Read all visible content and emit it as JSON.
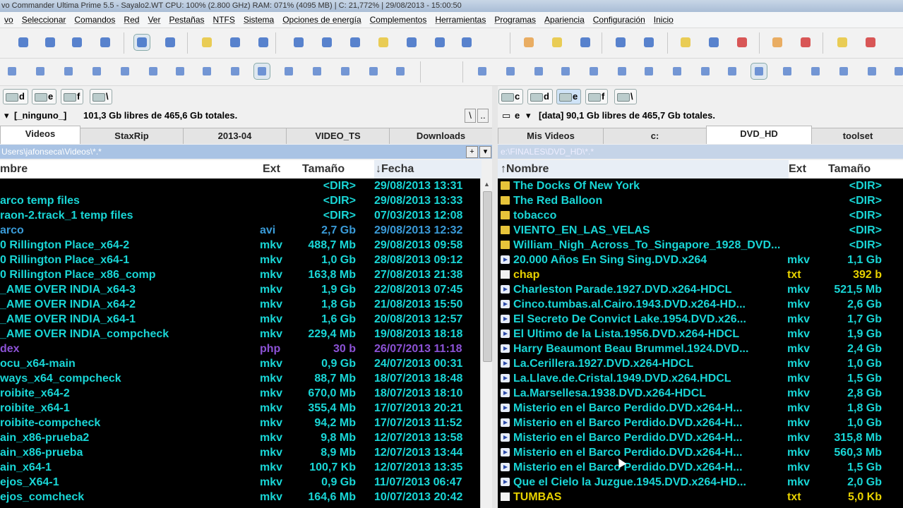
{
  "window": {
    "title": "vo  Commander Ultima Prime 5.5 - Sayalo2.WT  CPU: 100% (2.800 GHz)  RAM: 071% (4095 MB) | C: 21,772% | 29/08/2013 - 15:00:50"
  },
  "menu": [
    "vo",
    "Seleccionar",
    "Comandos",
    "Red",
    "Ver",
    "Pestañas",
    "NTFS",
    "Sistema",
    "Opciones de energía",
    "Complementos",
    "Herramientas",
    "Programas",
    "Apariencia",
    "Configuración",
    "Inicio"
  ],
  "toolbar_colors": {
    "accent_blue": "#3d6fc7",
    "orange": "#e8a14a",
    "yellow": "#e8c63a",
    "red": "#d43b3b"
  },
  "left": {
    "drives": [
      "d",
      "e",
      "f",
      "\\"
    ],
    "info_bullet": "▾",
    "info_drive": "[_ninguno_]",
    "info_text": "101,3 Gb libres de 465,6 Gb totales.",
    "info_btn_backslash": "\\",
    "info_btn_dots": "..",
    "tabs": [
      "Videos",
      "StaxRip",
      "2013-04",
      "VIDEO_TS",
      "Downloads"
    ],
    "active_tab": 0,
    "path": "Users\\jafonseca\\Videos\\*.*",
    "path_btn_plus": "+",
    "path_btn_down": "▾",
    "headers": {
      "name": "mbre",
      "ext": "Ext",
      "size": "Tamaño",
      "date": "↓Fecha"
    },
    "rows": [
      {
        "name": "",
        "ext": "",
        "size": "<DIR>",
        "date": "29/08/2013 13:31",
        "color": "cyan"
      },
      {
        "name": "arco temp files",
        "ext": "",
        "size": "<DIR>",
        "date": "29/08/2013 13:33",
        "color": "cyan"
      },
      {
        "name": "raon-2.track_1 temp files",
        "ext": "",
        "size": "<DIR>",
        "date": "07/03/2013 12:08",
        "color": "cyan"
      },
      {
        "name": "arco",
        "ext": "avi",
        "size": "2,7 Gb",
        "date": "29/08/2013 12:32",
        "color": "blue"
      },
      {
        "name": "0 Rillington Place_x64-2",
        "ext": "mkv",
        "size": "488,7 Mb",
        "date": "29/08/2013 09:58",
        "color": "cyan"
      },
      {
        "name": "0 Rillington Place_x64-1",
        "ext": "mkv",
        "size": "1,0 Gb",
        "date": "28/08/2013 09:12",
        "color": "cyan"
      },
      {
        "name": "0 Rillington Place_x86_comp",
        "ext": "mkv",
        "size": "163,8 Mb",
        "date": "27/08/2013 21:38",
        "color": "cyan"
      },
      {
        "name": "_AME OVER INDIA_x64-3",
        "ext": "mkv",
        "size": "1,9 Gb",
        "date": "22/08/2013 07:45",
        "color": "cyan"
      },
      {
        "name": "_AME OVER INDIA_x64-2",
        "ext": "mkv",
        "size": "1,8 Gb",
        "date": "21/08/2013 15:50",
        "color": "cyan"
      },
      {
        "name": "_AME OVER INDIA_x64-1",
        "ext": "mkv",
        "size": "1,6 Gb",
        "date": "20/08/2013 12:57",
        "color": "cyan"
      },
      {
        "name": "_AME OVER INDIA_compcheck",
        "ext": "mkv",
        "size": "229,4 Mb",
        "date": "19/08/2013 18:18",
        "color": "cyan"
      },
      {
        "name": "dex",
        "ext": "php",
        "size": "30 b",
        "date": "26/07/2013 11:18",
        "color": "purple"
      },
      {
        "name": "ocu_x64-main",
        "ext": "mkv",
        "size": "0,9 Gb",
        "date": "24/07/2013 00:31",
        "color": "cyan"
      },
      {
        "name": "ways_x64_compcheck",
        "ext": "mkv",
        "size": "88,7 Mb",
        "date": "18/07/2013 18:48",
        "color": "cyan"
      },
      {
        "name": "roibite_x64-2",
        "ext": "mkv",
        "size": "670,0 Mb",
        "date": "18/07/2013 18:10",
        "color": "cyan"
      },
      {
        "name": "roibite_x64-1",
        "ext": "mkv",
        "size": "355,4 Mb",
        "date": "17/07/2013 20:21",
        "color": "cyan"
      },
      {
        "name": "roibite-compcheck",
        "ext": "mkv",
        "size": "94,2 Mb",
        "date": "17/07/2013 11:52",
        "color": "cyan"
      },
      {
        "name": "ain_x86-prueba2",
        "ext": "mkv",
        "size": "9,8 Mb",
        "date": "12/07/2013 13:58",
        "color": "cyan"
      },
      {
        "name": "ain_x86-prueba",
        "ext": "mkv",
        "size": "8,9 Mb",
        "date": "12/07/2013 13:44",
        "color": "cyan"
      },
      {
        "name": "ain_x64-1",
        "ext": "mkv",
        "size": "100,7 Kb",
        "date": "12/07/2013 13:35",
        "color": "cyan"
      },
      {
        "name": "ejos_X64-1",
        "ext": "mkv",
        "size": "0,9 Gb",
        "date": "11/07/2013 06:47",
        "color": "cyan"
      },
      {
        "name": "ejos_comcheck",
        "ext": "mkv",
        "size": "164,6 Mb",
        "date": "10/07/2013 20:42",
        "color": "cyan"
      }
    ],
    "scroll_up": "▲"
  },
  "right": {
    "drives": [
      "c",
      "d",
      "e",
      "f",
      "\\"
    ],
    "info_bullet": "▭",
    "info_drive": "e",
    "info_text": "[data]  90,1 Gb libres de 465,7 Gb totales.",
    "tabs": [
      "Mis Videos",
      "c:",
      "DVD_HD",
      "toolset"
    ],
    "active_tab": 2,
    "path": "e:\\FINALES\\DVD_HD\\*.*",
    "headers": {
      "name": "↑Nombre",
      "ext": "Ext",
      "size": "Tamaño"
    },
    "rows": [
      {
        "icon": "folder",
        "name": "The Docks Of New York",
        "ext": "",
        "size": "<DIR>",
        "color": "cyan"
      },
      {
        "icon": "folder",
        "name": "The Red Balloon",
        "ext": "",
        "size": "<DIR>",
        "color": "cyan"
      },
      {
        "icon": "folder",
        "name": "tobacco",
        "ext": "",
        "size": "<DIR>",
        "color": "cyan"
      },
      {
        "icon": "folder",
        "name": "VIENTO_EN_LAS_VELAS",
        "ext": "",
        "size": "<DIR>",
        "color": "cyan"
      },
      {
        "icon": "folder",
        "name": "William_Nigh_Across_To_Singapore_1928_DVD...",
        "ext": "",
        "size": "<DIR>",
        "color": "cyan"
      },
      {
        "icon": "video",
        "name": "20.000 Años En Sing Sing.DVD.x264",
        "ext": "mkv",
        "size": "1,1 Gb",
        "color": "cyan"
      },
      {
        "icon": "text",
        "name": "chap",
        "ext": "txt",
        "size": "392 b",
        "color": "yellow"
      },
      {
        "icon": "video",
        "name": "Charleston Parade.1927.DVD.x264-HDCL",
        "ext": "mkv",
        "size": "521,5 Mb",
        "color": "cyan"
      },
      {
        "icon": "video",
        "name": "Cinco.tumbas.al.Cairo.1943.DVD.x264-HD...",
        "ext": "mkv",
        "size": "2,6 Gb",
        "color": "cyan"
      },
      {
        "icon": "video",
        "name": "El Secreto De Convict Lake.1954.DVD.x26...",
        "ext": "mkv",
        "size": "1,7 Gb",
        "color": "cyan"
      },
      {
        "icon": "video",
        "name": "El Ultimo de la Lista.1956.DVD.x264-HDCL",
        "ext": "mkv",
        "size": "1,9 Gb",
        "color": "cyan"
      },
      {
        "icon": "video",
        "name": "Harry Beaumont Beau Brummel.1924.DVD...",
        "ext": "mkv",
        "size": "2,4 Gb",
        "color": "cyan"
      },
      {
        "icon": "video",
        "name": "La.Cerillera.1927.DVD.x264-HDCL",
        "ext": "mkv",
        "size": "1,0 Gb",
        "color": "cyan"
      },
      {
        "icon": "video",
        "name": "La.Llave.de.Cristal.1949.DVD.x264.HDCL",
        "ext": "mkv",
        "size": "1,5 Gb",
        "color": "cyan"
      },
      {
        "icon": "video",
        "name": "La.Marsellesa.1938.DVD.x264-HDCL",
        "ext": "mkv",
        "size": "2,8 Gb",
        "color": "cyan"
      },
      {
        "icon": "video",
        "name": "Misterio en el Barco Perdido.DVD.x264-H...",
        "ext": "mkv",
        "size": "1,8 Gb",
        "color": "cyan"
      },
      {
        "icon": "video",
        "name": "Misterio en el Barco Perdido.DVD.x264-H...",
        "ext": "mkv",
        "size": "1,0 Gb",
        "color": "cyan"
      },
      {
        "icon": "video",
        "name": "Misterio en el Barco Perdido.DVD.x264-H...",
        "ext": "mkv",
        "size": "315,8 Mb",
        "color": "cyan"
      },
      {
        "icon": "video",
        "name": "Misterio en el Barco Perdido.DVD.x264-H...",
        "ext": "mkv",
        "size": "560,3 Mb",
        "color": "cyan"
      },
      {
        "icon": "video",
        "name": "Misterio en el Barco Perdido.DVD.x264-H...",
        "ext": "mkv",
        "size": "1,5 Gb",
        "color": "cyan"
      },
      {
        "icon": "video",
        "name": "Que el Cielo la Juzgue.1945.DVD.x264-HD...",
        "ext": "mkv",
        "size": "2,0 Gb",
        "color": "cyan"
      },
      {
        "icon": "text",
        "name": "TUMBAS",
        "ext": "txt",
        "size": "5,0 Kb",
        "color": "yellow"
      }
    ]
  }
}
